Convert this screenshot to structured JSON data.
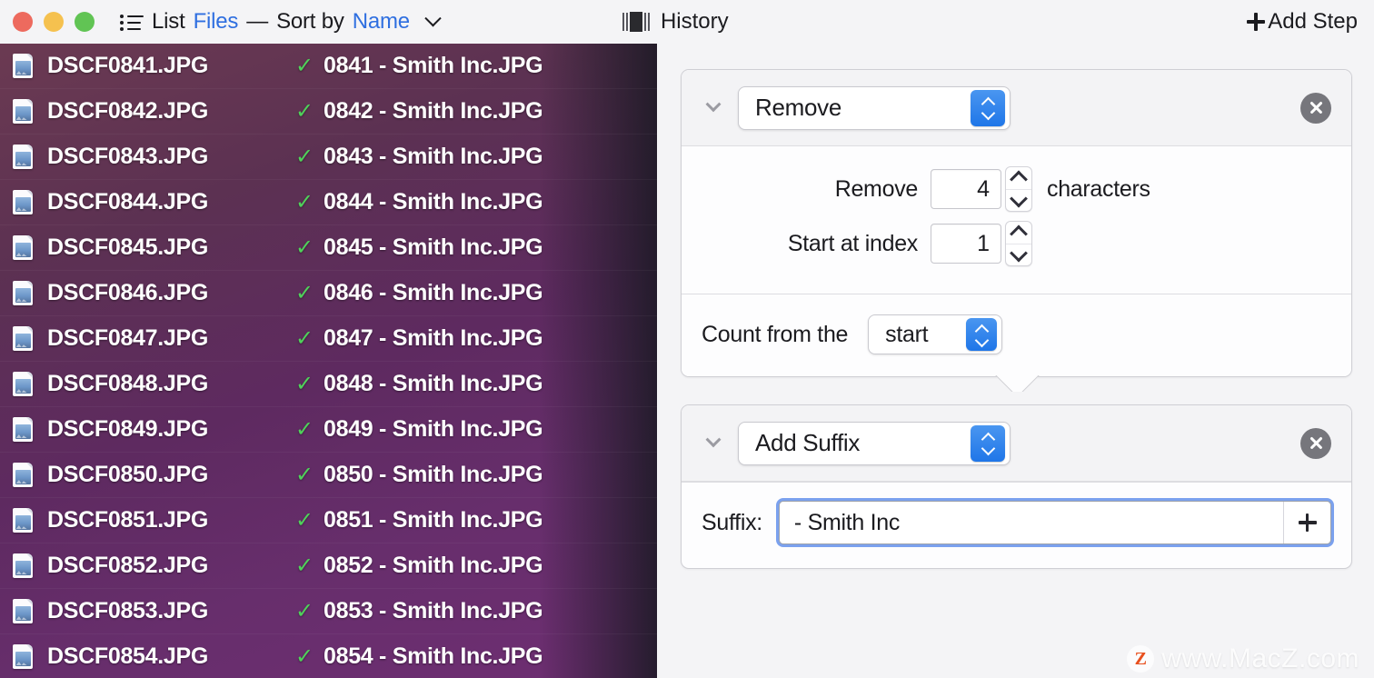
{
  "window": {
    "traffic_lights": [
      {
        "name": "close",
        "color": "#ED6A5E"
      },
      {
        "name": "minimize",
        "color": "#F5C14F"
      },
      {
        "name": "zoom",
        "color": "#61C454"
      }
    ]
  },
  "toolbar": {
    "list_icon": "list-icon",
    "title_list": "List",
    "title_files": "Files",
    "title_dash": "—",
    "title_sortby": "Sort by",
    "title_sortkey": "Name",
    "sort_chevron": "chevron-down-icon",
    "history_icon": "column-view-icon",
    "history_label": "History",
    "add_step_plus": "plus-icon",
    "add_step_label": "Add Step",
    "link_color": "#2F6FE0"
  },
  "filelist": {
    "check_glyph": "✓",
    "check_color": "#4FD25A",
    "rows": [
      {
        "original": "DSCF0841.JPG",
        "renamed": "0841 - Smith Inc.JPG"
      },
      {
        "original": "DSCF0842.JPG",
        "renamed": "0842 - Smith Inc.JPG"
      },
      {
        "original": "DSCF0843.JPG",
        "renamed": "0843 - Smith Inc.JPG"
      },
      {
        "original": "DSCF0844.JPG",
        "renamed": "0844 - Smith Inc.JPG"
      },
      {
        "original": "DSCF0845.JPG",
        "renamed": "0845 - Smith Inc.JPG"
      },
      {
        "original": "DSCF0846.JPG",
        "renamed": "0846 - Smith Inc.JPG"
      },
      {
        "original": "DSCF0847.JPG",
        "renamed": "0847 - Smith Inc.JPG"
      },
      {
        "original": "DSCF0848.JPG",
        "renamed": "0848 - Smith Inc.JPG"
      },
      {
        "original": "DSCF0849.JPG",
        "renamed": "0849 - Smith Inc.JPG"
      },
      {
        "original": "DSCF0850.JPG",
        "renamed": "0850 - Smith Inc.JPG"
      },
      {
        "original": "DSCF0851.JPG",
        "renamed": "0851 - Smith Inc.JPG"
      },
      {
        "original": "DSCF0852.JPG",
        "renamed": "0852 - Smith Inc.JPG"
      },
      {
        "original": "DSCF0853.JPG",
        "renamed": "0853 - Smith Inc.JPG"
      },
      {
        "original": "DSCF0854.JPG",
        "renamed": "0854 - Smith Inc.JPG"
      }
    ]
  },
  "steps": [
    {
      "id": "remove",
      "type_label": "Remove",
      "disclosure_icon": "chevron-down-icon",
      "close_icon": "close-circle-icon",
      "fields": {
        "remove_label": "Remove",
        "remove_value": "4",
        "remove_unit": "characters",
        "start_label": "Start at index",
        "start_value": "1",
        "count_label": "Count from the",
        "count_value": "start"
      }
    },
    {
      "id": "add-suffix",
      "type_label": "Add Suffix",
      "disclosure_icon": "chevron-down-icon",
      "close_icon": "close-circle-icon",
      "fields": {
        "suffix_label": "Suffix:",
        "suffix_value": "- Smith Inc",
        "token_add_icon": "plus-icon"
      }
    }
  ],
  "watermark": {
    "logo": "Z",
    "text": "www.MacZ.com"
  }
}
